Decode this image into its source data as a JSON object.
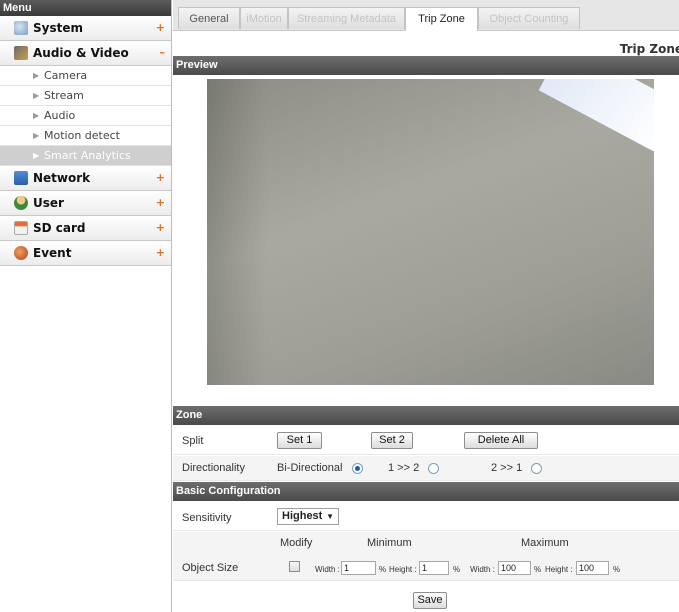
{
  "sidebar": {
    "menu_title": "Menu",
    "categories": [
      {
        "label": "System",
        "toggle": "+",
        "icon": "system-icon"
      },
      {
        "label": "Audio & Video",
        "toggle": "–",
        "icon": "audio-video-icon"
      },
      {
        "label": "Network",
        "toggle": "+",
        "icon": "network-icon"
      },
      {
        "label": "User",
        "toggle": "+",
        "icon": "user-icon"
      },
      {
        "label": "SD card",
        "toggle": "+",
        "icon": "sd-card-icon"
      },
      {
        "label": "Event",
        "toggle": "+",
        "icon": "event-icon"
      }
    ],
    "sub_items": [
      "Camera",
      "Stream",
      "Audio",
      "Motion detect",
      "Smart Analytics"
    ],
    "selected_sub": "Smart Analytics"
  },
  "tabs": [
    {
      "label": "General",
      "state": "normal"
    },
    {
      "label": "iMotion",
      "state": "disabled"
    },
    {
      "label": "Streaming Metadata",
      "state": "disabled"
    },
    {
      "label": "Trip Zone",
      "state": "active"
    },
    {
      "label": "Object Counting",
      "state": "disabled"
    }
  ],
  "page_title": "Trip Zone",
  "preview": {
    "title": "Preview"
  },
  "zone": {
    "title": "Zone",
    "split_label": "Split",
    "set1": "Set 1",
    "set2": "Set 2",
    "delete_all": "Delete All",
    "direction_label": "Directionality",
    "options": [
      "Bi-Directional",
      "1 >> 2",
      "2 >> 1"
    ],
    "selected_option": "Bi-Directional"
  },
  "basic": {
    "title": "Basic Configuration",
    "sensitivity_label": "Sensitivity",
    "sensitivity_value": "Highest",
    "modify_header": "Modify",
    "minimum_header": "Minimum",
    "maximum_header": "Maximum",
    "object_size_label": "Object Size",
    "min_width_label": "Width :",
    "min_width": "1",
    "min_height_label": "Height :",
    "min_height": "1",
    "max_width_label": "Width :",
    "max_width": "100",
    "max_height_label": "Height :",
    "max_height": "100",
    "unit": "%"
  },
  "save_label": "Save",
  "colors": {
    "accent_toggle": "#e07020",
    "section_bar": "#5a5a5a",
    "radio_dot": "#1a5fb4"
  }
}
